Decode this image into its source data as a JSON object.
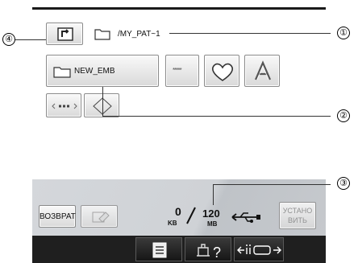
{
  "path": {
    "label": "/MY_PAT~1"
  },
  "folder_button": {
    "label": "NEW_EMB"
  },
  "pattern_buttons": {
    "stars_label": "*****"
  },
  "status": {
    "used_value": "0",
    "used_unit": "KB",
    "total_value": "120",
    "total_unit": "MB"
  },
  "controls": {
    "back_label": "ВОЗВРАТ",
    "set_label_line1": "УСТАНО",
    "set_label_line2": "ВИТЬ"
  },
  "callouts": {
    "c1": "①",
    "c2": "②",
    "c3": "③",
    "c4": "④"
  }
}
